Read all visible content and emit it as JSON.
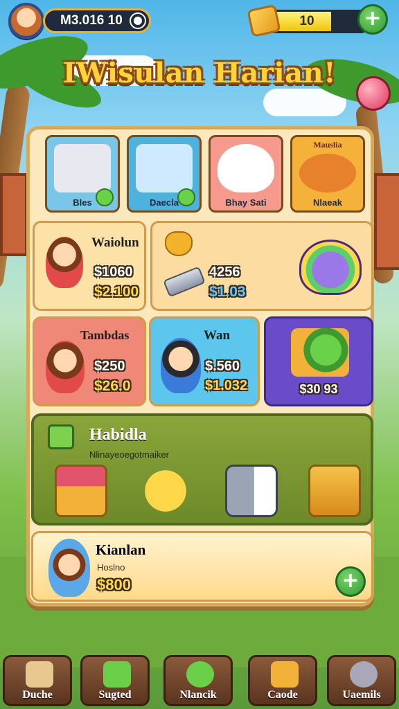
{
  "header": {
    "coins": "M3.016 10",
    "gems": "10",
    "gem_fill": 0.65
  },
  "title": "IWisulan Harian!",
  "categories": [
    {
      "label": "Bles",
      "bg": "#7ac6e8",
      "art": "#e8e8f0",
      "icon": "juice-bottle-icon"
    },
    {
      "label": "Daecla",
      "bg": "#4eb2dd",
      "art": "#cfe9ff",
      "icon": "phone-icon"
    },
    {
      "label": "Bhay Sati",
      "bg": "#f59a8c",
      "art": "#ffffff",
      "icon": "ghost-icon"
    },
    {
      "label": "Nlaeak",
      "bg": "#f4b23a",
      "art": "#e7812b",
      "top_label": "Mauslia",
      "icon": "monster-icon"
    }
  ],
  "offers": [
    {
      "name": "Waiolun",
      "price1": "$1060",
      "price2": "$2.100",
      "bg": "#fde2a8",
      "icon": "girl-hat-icon"
    },
    {
      "name": "",
      "price1": "4256",
      "price2": "$1.03",
      "bg": "#fddca2",
      "icon": "gold-heart-icon"
    },
    {
      "name": "Tambdas",
      "price1": "$250",
      "price2": "$26.0",
      "bg": "#f08878",
      "icon": "girl-icon"
    },
    {
      "name": "Wan",
      "price1": "$.560",
      "price2": "$1.032",
      "bg": "#5cc6ec",
      "icon": "boy-icon"
    },
    {
      "name": "",
      "price1": "$30 93",
      "price2": "",
      "bg": "#6a4cc8",
      "icon": "gift-monster-icon"
    }
  ],
  "special": {
    "title": "Habidla",
    "subtitle": "Nlinayeoegotmaiker",
    "rewards": [
      "treasure-chest-icon",
      "star-face-icon",
      "phone-cat-icon",
      "gold-chest-icon"
    ]
  },
  "bottom_offer": {
    "name": "Kianlan",
    "sub": "Hoslno",
    "price": "$800"
  },
  "nav": [
    {
      "label": "Duche",
      "icon": "puzzle-icon",
      "color": "#e8c890"
    },
    {
      "label": "Sugted",
      "icon": "basket-icon",
      "color": "#6ccf4a"
    },
    {
      "label": "Nlancik",
      "icon": "slime-icon",
      "color": "#6ccf4a"
    },
    {
      "label": "Caode",
      "icon": "box-icon",
      "color": "#f2b23a"
    },
    {
      "label": "Uaemils",
      "icon": "medal-icon",
      "color": "#a8a8b8"
    }
  ]
}
